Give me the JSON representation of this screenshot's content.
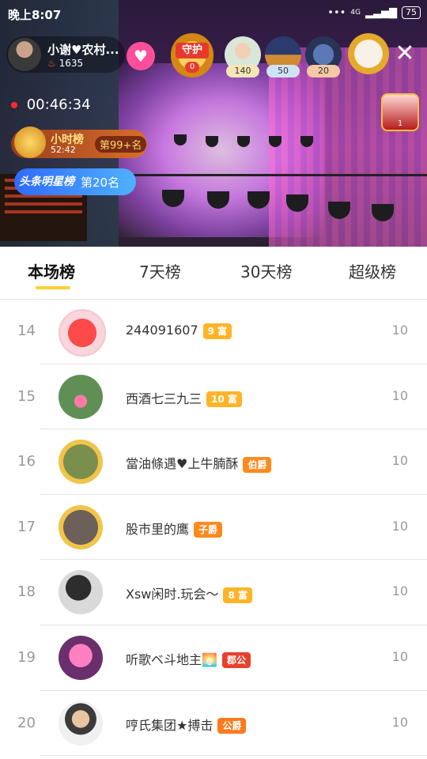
{
  "status": {
    "time": "晚上8:07",
    "network": "4G",
    "battery": "75"
  },
  "streamer": {
    "name": "小谢♥农村...",
    "fans": "1635"
  },
  "guard": {
    "label": "守护",
    "count": "0"
  },
  "viewers": [
    {
      "count": "140",
      "color": "#f5e6b5"
    },
    {
      "count": "50",
      "color": "#cfe3f6"
    },
    {
      "count": "20",
      "color": "#f4c9a7"
    }
  ],
  "corner_badge": "1",
  "timer": "00:46:34",
  "hour_rank": {
    "title": "小时榜",
    "time": "52:42",
    "position": "第99+名"
  },
  "star_rank": {
    "title": "头条明星榜",
    "position": "第20名"
  },
  "tabs": [
    "本场榜",
    "7天榜",
    "30天榜",
    "超级榜"
  ],
  "rows": [
    {
      "rank": "14",
      "name": "244091607",
      "badge": "9 富",
      "badge_color": "#ffb428",
      "score": "10"
    },
    {
      "rank": "15",
      "name": "西酒七三九三",
      "badge": "10 富",
      "badge_color": "#ffb428",
      "score": "10"
    },
    {
      "rank": "16",
      "name": "當油條遇♥上牛腩酥",
      "badge": "伯爵",
      "badge_color": "#ff8a1c",
      "score": "10"
    },
    {
      "rank": "17",
      "name": "股市里的鹰",
      "badge": "子爵",
      "badge_color": "#ff8a1c",
      "score": "10"
    },
    {
      "rank": "18",
      "name": "Xsw闲时.玩会～",
      "badge": "8 富",
      "badge_color": "#ffb428",
      "score": "10"
    },
    {
      "rank": "19",
      "name": "听歌ベ斗地主🌅",
      "badge": "郡公",
      "badge_color": "#e8412b",
      "score": "10"
    },
    {
      "rank": "20",
      "name": "哼氏集团★搏击",
      "badge": "公爵",
      "badge_color": "#ff7a1c",
      "score": "10"
    }
  ],
  "icons": {
    "signal": "signal-icon",
    "heart": "heart-icon",
    "close": "close-icon",
    "fire": "fire-icon"
  }
}
